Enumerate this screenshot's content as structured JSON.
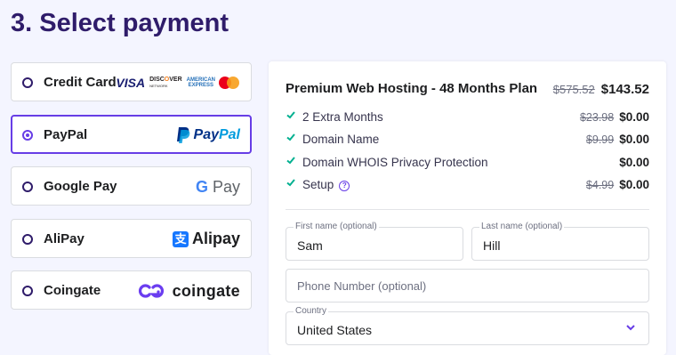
{
  "heading": "3. Select payment",
  "payment_methods": [
    {
      "id": "credit-card",
      "label": "Credit Card",
      "logos": {
        "visa": "VISA",
        "discover_1": "DISC",
        "discover_2": "VER",
        "discover_sub": "NETWORK",
        "amex_1": "AMERICAN",
        "amex_2": "EXPRESS"
      }
    },
    {
      "id": "paypal",
      "label": "PayPal",
      "selected": true,
      "logo_1": "Pay",
      "logo_2": "Pal"
    },
    {
      "id": "google-pay",
      "label": "Google Pay",
      "logo_g": "G",
      "logo_pay": "Pay"
    },
    {
      "id": "alipay",
      "label": "AliPay",
      "logo_mark": "支",
      "logo_text": "Alipay"
    },
    {
      "id": "coingate",
      "label": "Coingate",
      "logo_text": "coingate"
    }
  ],
  "summary": {
    "plan_name": "Premium Web Hosting - 48 Months Plan",
    "plan_old_price": "$575.52",
    "plan_price": "$143.52",
    "items": [
      {
        "label": "2 Extra Months",
        "old_price": "$23.98",
        "price": "$0.00"
      },
      {
        "label": "Domain Name",
        "old_price": "$9.99",
        "price": "$0.00"
      },
      {
        "label": "Domain WHOIS Privacy Protection",
        "old_price": "",
        "price": "$0.00"
      },
      {
        "label": "Setup",
        "help": "?",
        "old_price": "$4.99",
        "price": "$0.00"
      }
    ]
  },
  "form": {
    "first_name": {
      "label": "First name (optional)",
      "value": "Sam"
    },
    "last_name": {
      "label": "Last name (optional)",
      "value": "Hill"
    },
    "phone": {
      "placeholder": "Phone Number (optional)"
    },
    "country": {
      "label": "Country",
      "value": "United States"
    }
  },
  "colors": {
    "accent": "#673de6",
    "heading": "#2f1c6a",
    "check": "#00b090",
    "background": "#f4f5ff"
  }
}
